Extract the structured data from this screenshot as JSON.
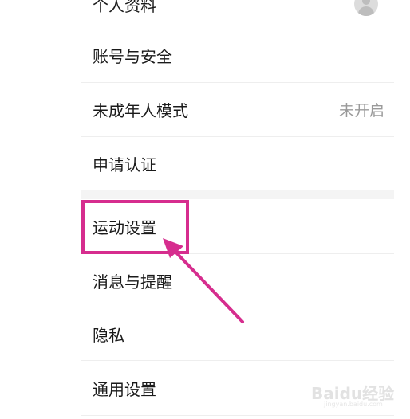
{
  "settings": {
    "rows": [
      {
        "label": "个人资料",
        "value": ""
      },
      {
        "label": "账号与安全",
        "value": ""
      },
      {
        "label": "未成年人模式",
        "value": "未开启"
      },
      {
        "label": "申请认证",
        "value": ""
      },
      {
        "label": "运动设置",
        "value": ""
      },
      {
        "label": "消息与提醒",
        "value": ""
      },
      {
        "label": "隐私",
        "value": ""
      },
      {
        "label": "通用设置",
        "value": ""
      }
    ]
  },
  "annotation": {
    "color": "#d62d8e"
  },
  "watermark": {
    "text": "Baidu经验",
    "subtext": "jingyan.baidu.com"
  }
}
